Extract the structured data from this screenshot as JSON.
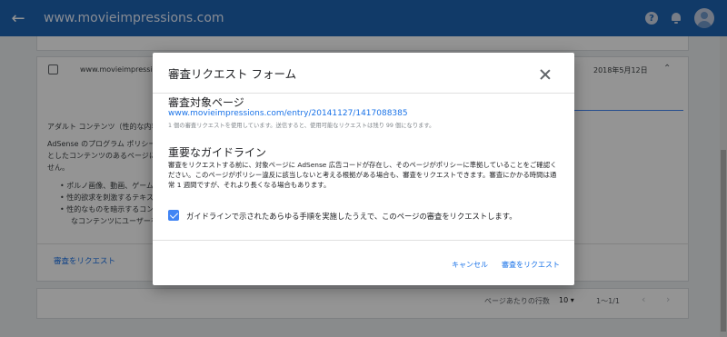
{
  "appbar": {
    "title": "www.movieimpressions.com",
    "back_icon": "arrow-left-icon",
    "help_icon": "help-icon",
    "notifications_icon": "bell-icon",
    "account_icon": "avatar-icon",
    "color": "#1e64b4"
  },
  "background": {
    "row": {
      "url": "www.movieimpressio",
      "date": "2018年5月12日"
    },
    "text_lines": [
      "アダルト コンテンツ（性的な内容）",
      "AdSense のプログラム ポリシーに",
      "としたコンテンツのあるページに",
      "せん。"
    ],
    "bullets": [
      "ポルノ画像、動画、ゲーム",
      "性的欲求を刺激するテキス",
      "性的なものを暗示するコン",
      "なコンテンツにユーザーを"
    ],
    "request_link": "審査をリクエスト",
    "pager": {
      "rows_label": "ページあたりの行数",
      "rows_value": "10",
      "range": "1〜1/1"
    }
  },
  "dialog": {
    "title": "審査リクエスト フォーム",
    "page_heading": "審査対象ページ",
    "page_url": "www.movieimpressions.com/entry/20141127/1417088385",
    "quota_note": "1 個の審査リクエストを使用しています。送信すると、使用可能なリクエストは残り 99 個になります。",
    "guidelines_heading": "重要なガイドライン",
    "guidelines_text": "審査をリクエストする前に、対象ページに AdSense 広告コードが存在し、そのページがポリシーに準拠していることをご確認ください。このページがポリシー違反に該当しないと考える根拠がある場合も、審査をリクエストできます。審査にかかる時間は通常 1 週間ですが、それより長くなる場合もあります。",
    "confirm_label": "ガイドラインで示されたあらゆる手順を実施したうえで、このページの審査をリクエストします。",
    "confirm_checked": true,
    "cancel_label": "キャンセル",
    "submit_label": "審査をリクエスト",
    "accent": "#1a73e8"
  }
}
